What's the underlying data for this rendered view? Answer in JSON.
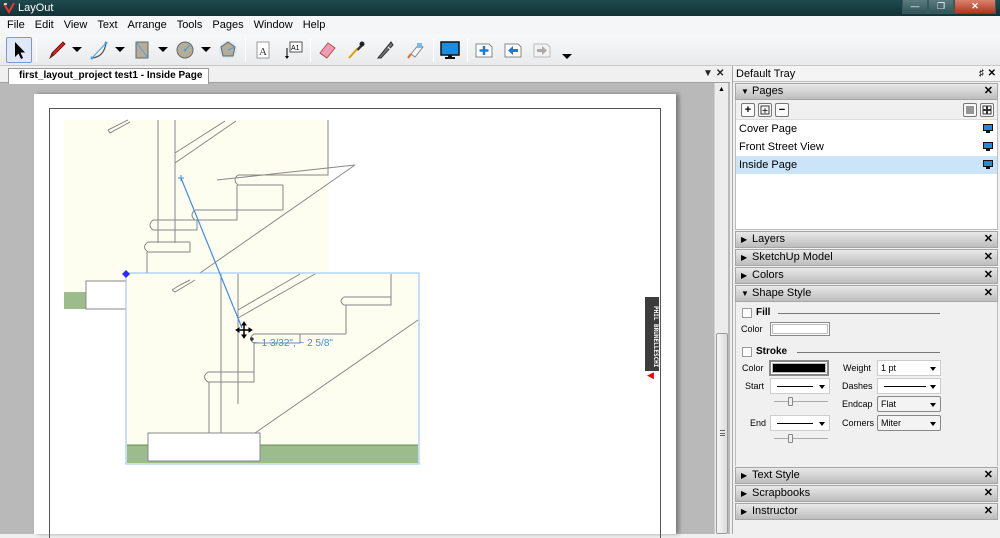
{
  "window": {
    "title": "LayOut",
    "controls": [
      "minimize",
      "restore",
      "close"
    ]
  },
  "menubar": [
    {
      "label": "File",
      "accel": "F"
    },
    {
      "label": "Edit",
      "accel": "E"
    },
    {
      "label": "View",
      "accel": "V"
    },
    {
      "label": "Text",
      "accel": "T"
    },
    {
      "label": "Arrange",
      "accel": "A"
    },
    {
      "label": "Tools",
      "accel": "T"
    },
    {
      "label": "Pages",
      "accel": "P"
    },
    {
      "label": "Window",
      "accel": "W"
    },
    {
      "label": "Help",
      "accel": "H"
    }
  ],
  "toolbar": {
    "tools": [
      {
        "name": "select-tool",
        "icon": "arrow-pointer-icon",
        "active": true
      },
      {
        "name": "line-tool",
        "icon": "pencil-icon",
        "dropdown": true
      },
      {
        "name": "arc-tool",
        "icon": "arc-icon",
        "dropdown": true
      },
      {
        "name": "rectangle-tool",
        "icon": "rectangle-icon",
        "dropdown": true
      },
      {
        "name": "circle-tool",
        "icon": "circle-icon",
        "dropdown": true
      },
      {
        "name": "polygon-tool",
        "icon": "polygon-icon"
      },
      {
        "name": "text-tool",
        "icon": "text-icon"
      },
      {
        "name": "label-tool",
        "icon": "label-icon"
      },
      {
        "name": "eraser-tool",
        "icon": "eraser-icon"
      },
      {
        "name": "style-tool",
        "icon": "eyedropper-icon"
      },
      {
        "name": "split-tool",
        "icon": "split-icon"
      },
      {
        "name": "join-tool",
        "icon": "glue-icon"
      },
      {
        "name": "presentation-tool",
        "icon": "monitor-icon"
      },
      {
        "name": "add-page-tool",
        "icon": "add-page-icon"
      },
      {
        "name": "previous-page-tool",
        "icon": "previous-page-icon"
      },
      {
        "name": "next-page-tool",
        "icon": "next-page-icon",
        "disabled": true
      }
    ]
  },
  "document": {
    "tab_label": "first_layout_project test1 - Inside Page",
    "dimension_readout": "~ 1 3/32\", ~ 2 5/8\"",
    "title_block_text": "PHIL BRUNELLESCHI"
  },
  "tray": {
    "title": "Default Tray",
    "pages_panel": {
      "title": "Pages",
      "expanded": true,
      "buttons": [
        "+",
        "duplicate",
        "−"
      ],
      "items": [
        {
          "label": "Cover Page",
          "selected": false
        },
        {
          "label": "Front Street View",
          "selected": false
        },
        {
          "label": "Inside Page",
          "selected": true
        }
      ]
    },
    "collapsed_panels_top": [
      "Layers",
      "SketchUp Model",
      "Colors"
    ],
    "shape_style": {
      "title": "Shape Style",
      "fill_label": "Fill",
      "fill_checked": false,
      "fill_color_label": "Color",
      "fill_color": "#ffffff",
      "stroke_label": "Stroke",
      "stroke_checked": false,
      "stroke_color_label": "Color",
      "stroke_color": "#000000",
      "weight_label": "Weight",
      "weight_value": "1 pt",
      "start_label": "Start",
      "dashes_label": "Dashes",
      "endcap_label": "Endcap",
      "endcap_value": "Flat",
      "end_label": "End",
      "corners_label": "Corners",
      "corners_value": "Miter"
    },
    "collapsed_panels_bottom": [
      "Text Style",
      "Scrapbooks",
      "Instructor"
    ]
  },
  "colors": {
    "selection_blue": "#3f8cf0",
    "handle_blue": "#2b2bff",
    "wall_cream": "#fdfdf0",
    "ground_green": "#9cbc8c",
    "selected_page_bg": "#cbe4f8"
  }
}
